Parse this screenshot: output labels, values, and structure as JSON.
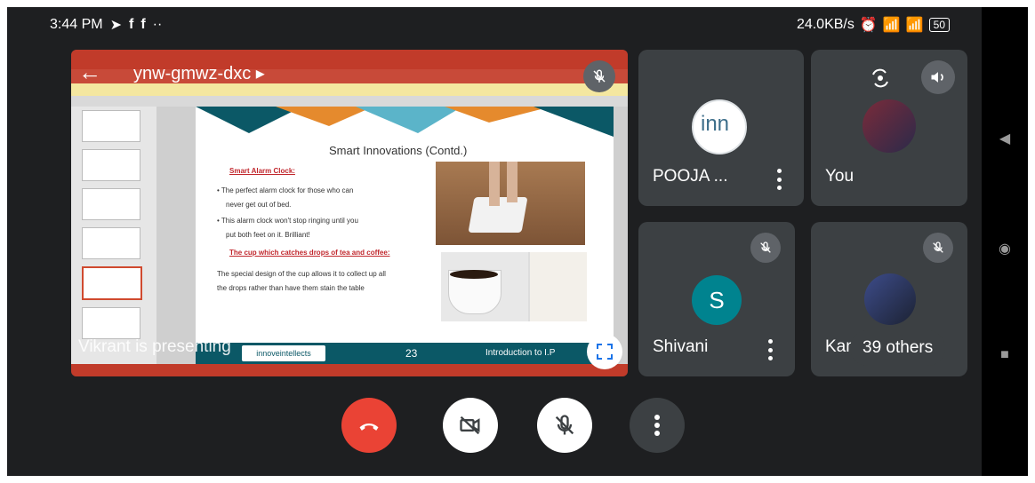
{
  "status_bar": {
    "time": "3:44 PM",
    "network_speed": "24.0KB/s",
    "battery": "50"
  },
  "meeting": {
    "code": "ynw-gmwz-dxc",
    "presenting_label": "Vikrant is presenting"
  },
  "slide": {
    "title": "Smart Innovations (Contd.)",
    "heading1": "Smart Alarm Clock:",
    "bullet1a": "The perfect alarm clock for those who can",
    "bullet1b": "never get out of bed.",
    "bullet2a": "This alarm clock won't stop ringing until you",
    "bullet2b": "put both feet on it. Brilliant!",
    "heading2": "The cup which catches drops of tea and coffee:",
    "para1": "The special design of the cup allows it to collect up all",
    "para2": "the drops rather than have them stain the table",
    "footer_logo": "innoveintellects",
    "footer_page": "23",
    "footer_title": "Introduction to I.P"
  },
  "participants": [
    {
      "name": "POOJA ...",
      "avatar_text": "inn"
    },
    {
      "name": "You"
    },
    {
      "name": "Shivani",
      "avatar_letter": "S"
    },
    {
      "name": "Kama"
    }
  ],
  "others_label": "39 others",
  "colors": {
    "end_call": "#ea4335",
    "tile_bg": "#3c4043",
    "avatar_s": "#00838f",
    "background": "#1e1f21"
  }
}
